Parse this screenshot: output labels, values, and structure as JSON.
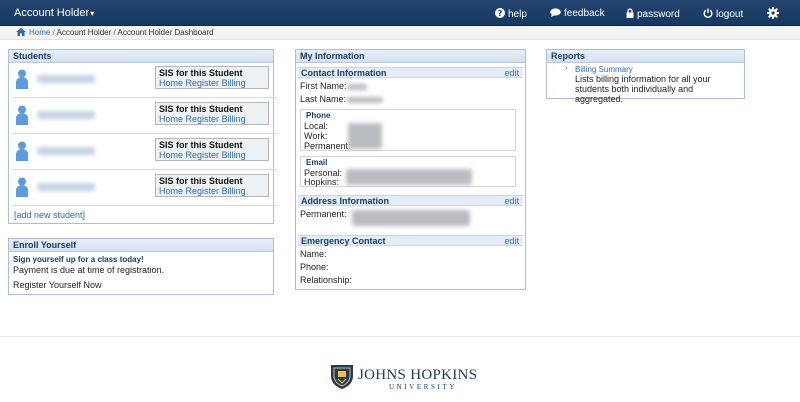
{
  "nav": {
    "brand": "Account Holder",
    "help": "help",
    "feedback": "feedback",
    "password": "password",
    "logout": "logout",
    "icons": [
      "question-circle-icon",
      "speech-bubble-icon",
      "lock-icon",
      "power-icon",
      "gear-icon"
    ]
  },
  "breadcrumb": {
    "home": "Home",
    "sep": "/",
    "level1": "Account Holder",
    "level2": "Account Holder Dashboard"
  },
  "students": {
    "title": "Students",
    "sis_title": "SIS for this Student",
    "link_home": "Home",
    "link_register": "Register",
    "link_billing": "Billing",
    "add_student": "[add new student]"
  },
  "enroll": {
    "title": "Enroll Yourself",
    "headline": "Sign yourself up for a class today!",
    "note": "Payment is due at time of registration.",
    "action": "Register Yourself Now"
  },
  "info": {
    "title": "My Information",
    "contact_title": "Contact Information",
    "edit": "edit",
    "first_name": "First Name:",
    "last_name": "Last Name:",
    "phone_title": "Phone",
    "local": "Local:",
    "work": "Work:",
    "permanent": "Permanent:",
    "email_title": "Email",
    "personal": "Personal:",
    "hopkins": "Hopkins:",
    "address_title": "Address Information",
    "address_permanent": "Permanent:",
    "emergency_title": "Emergency Contact",
    "name": "Name:",
    "phone": "Phone:",
    "relationship": "Relationship:"
  },
  "reports": {
    "title": "Reports",
    "item_link": "Billing Summary",
    "item_desc": "Lists billing information for all your students both individually and aggregated."
  },
  "footer": {
    "logo_main": "JOHNS HOPKINS",
    "logo_sub": "UNIVERSITY"
  },
  "colors": {
    "nav_bg": "#1a3b64",
    "link": "#2e6bb0",
    "panel_border": "#a8bfd8"
  }
}
